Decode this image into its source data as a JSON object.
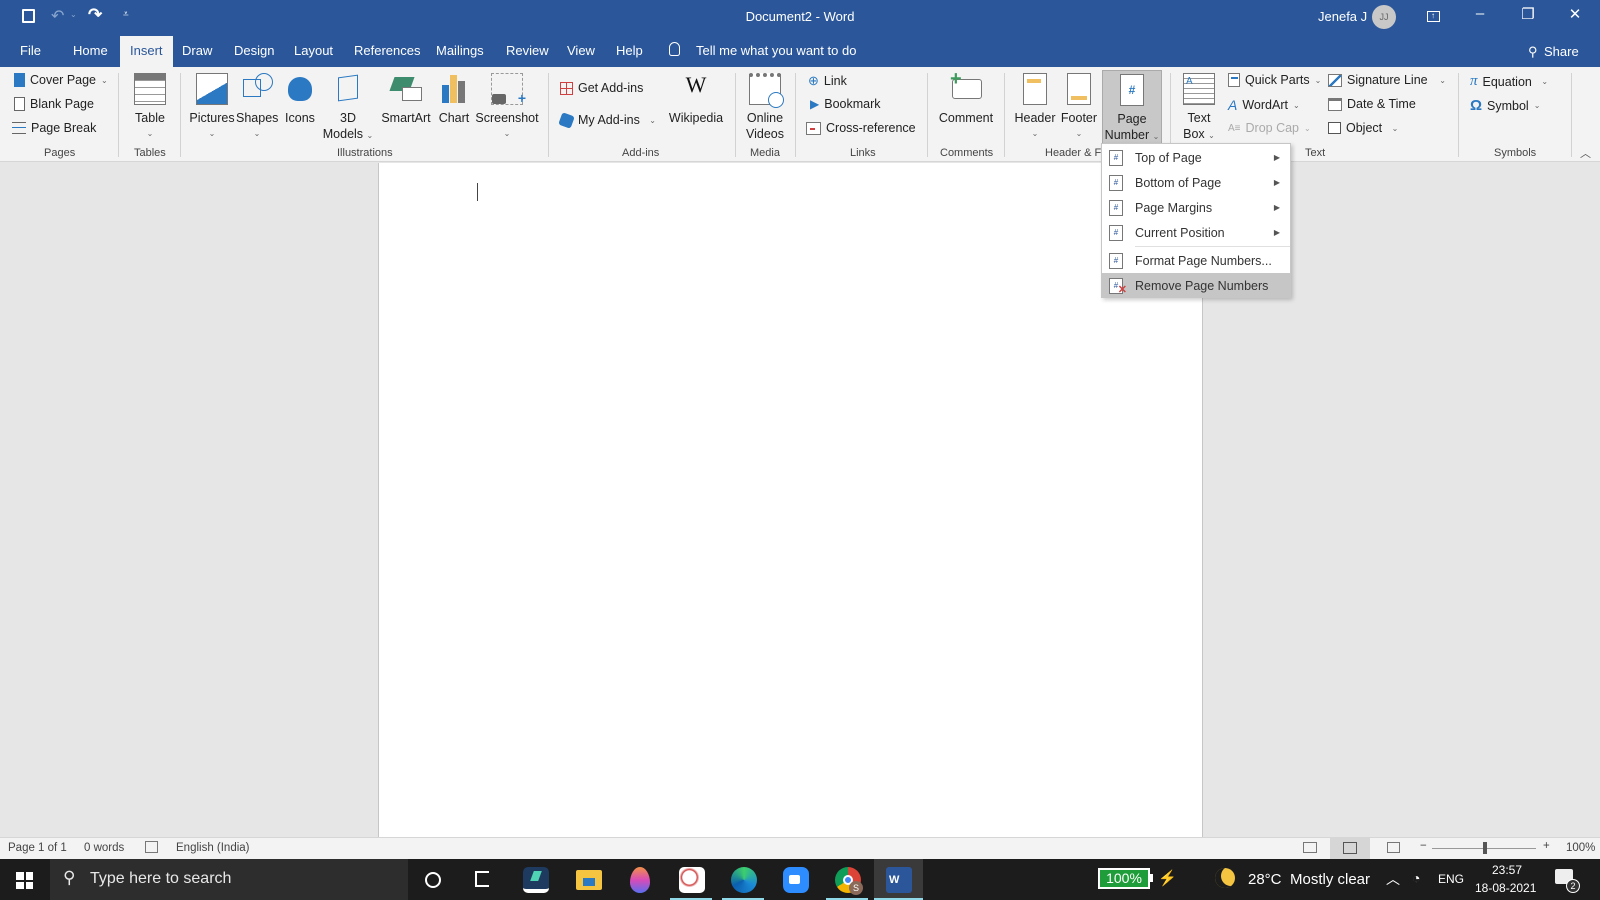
{
  "window": {
    "title": "Document2  -  Word",
    "user_name": "Jenefa J",
    "user_initials": "JJ",
    "quick_access": {
      "save": "save-icon",
      "undo": "undo-icon",
      "redo": "redo-icon",
      "customize": "customize-icon"
    },
    "controls": {
      "ribbon_display": "ribbon-display-icon",
      "minimize": "–",
      "restore": "❐",
      "close": "✕"
    }
  },
  "tabs": [
    {
      "label": "File"
    },
    {
      "label": "Home"
    },
    {
      "label": "Insert",
      "active": true
    },
    {
      "label": "Draw"
    },
    {
      "label": "Design"
    },
    {
      "label": "Layout"
    },
    {
      "label": "References"
    },
    {
      "label": "Mailings"
    },
    {
      "label": "Review"
    },
    {
      "label": "View"
    },
    {
      "label": "Help"
    }
  ],
  "tell_me": "Tell me what you want to do",
  "share_label": "Share",
  "ribbon": {
    "groups": {
      "pages": "Pages",
      "tables": "Tables",
      "illustrations": "Illustrations",
      "addins": "Add-ins",
      "media": "Media",
      "links": "Links",
      "comments": "Comments",
      "header_footer": "Header & F",
      "text": "Text",
      "symbols": "Symbols"
    },
    "pages": {
      "cover_page": "Cover Page",
      "blank_page": "Blank Page",
      "page_break": "Page Break"
    },
    "tables": {
      "table": "Table"
    },
    "illustrations": {
      "pictures": "Pictures",
      "shapes": "Shapes",
      "icons": "Icons",
      "models_line1": "3D",
      "models_line2": "Models",
      "smartart": "SmartArt",
      "chart": "Chart",
      "screenshot": "Screenshot"
    },
    "addins": {
      "get_addins": "Get Add-ins",
      "my_addins": "My Add-ins",
      "wikipedia": "Wikipedia"
    },
    "media": {
      "online_line1": "Online",
      "online_line2": "Videos"
    },
    "links": {
      "link": "Link",
      "bookmark": "Bookmark",
      "cross_reference": "Cross-reference"
    },
    "comments": {
      "comment": "Comment"
    },
    "header_footer": {
      "header": "Header",
      "footer": "Footer",
      "page_number_line1": "Page",
      "page_number_line2": "Number"
    },
    "text": {
      "textbox_line1": "Text",
      "textbox_line2": "Box",
      "quick_parts": "Quick Parts",
      "wordart": "WordArt",
      "drop_cap": "Drop Cap",
      "signature_line": "Signature Line",
      "date_time": "Date & Time",
      "object": "Object"
    },
    "symbols": {
      "equation": "Equation",
      "symbol": "Symbol"
    }
  },
  "page_number_menu": {
    "items": [
      {
        "label": "Top of Page",
        "submenu": true
      },
      {
        "label": "Bottom of Page",
        "submenu": true
      },
      {
        "label": "Page Margins",
        "submenu": true
      },
      {
        "label": "Current Position",
        "submenu": true
      },
      {
        "label": "Format Page Numbers...",
        "submenu": false
      },
      {
        "label": "Remove Page Numbers",
        "submenu": false,
        "highlighted": true
      }
    ]
  },
  "status_bar": {
    "page": "Page 1 of 1",
    "words": "0 words",
    "language": "English (India)",
    "zoom": "100%",
    "zoom_minus": "−",
    "zoom_plus": "+",
    "zoom_level_percent": 100
  },
  "taskbar": {
    "search_placeholder": "Type here to search",
    "battery": "100%",
    "weather_temp": "28°C",
    "weather_text": "Mostly clear",
    "language": "ENG",
    "time": "23:57",
    "date": "18-08-2021",
    "notification_count": "2",
    "apps": [
      "task-view",
      "filmora",
      "file-explorer",
      "paint-drop",
      "snipping-tool",
      "edge",
      "zoom",
      "chrome",
      "word"
    ]
  },
  "colors": {
    "accent": "#2b579a",
    "ribbon_bg": "#f3f3f3",
    "taskbar": "#1c1c1c",
    "battery": "#1f9d3a"
  }
}
